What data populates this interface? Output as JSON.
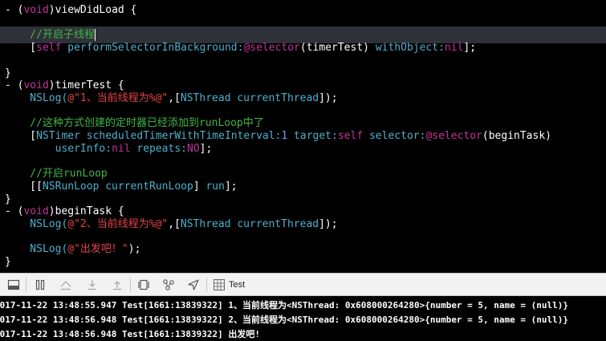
{
  "editor": {
    "lines": [
      [
        {
          "t": "- (",
          "c": "plain"
        },
        {
          "t": "void",
          "c": "keyword"
        },
        {
          "t": ")viewDidLoad {",
          "c": "plain"
        }
      ],
      [],
      [
        {
          "t": "    //开启子线程",
          "c": "comment"
        }
      ],
      [
        {
          "t": "    [",
          "c": "plain"
        },
        {
          "t": "self",
          "c": "keyword"
        },
        {
          "t": " performSelectorInBackground:",
          "c": "selector"
        },
        {
          "t": "@selector",
          "c": "keyword"
        },
        {
          "t": "(timerTest) ",
          "c": "plain"
        },
        {
          "t": "withObject:",
          "c": "selector"
        },
        {
          "t": "nil",
          "c": "keyword"
        },
        {
          "t": "];",
          "c": "plain"
        }
      ],
      [],
      [
        {
          "t": "}",
          "c": "plain"
        }
      ],
      [
        {
          "t": "- (",
          "c": "plain"
        },
        {
          "t": "void",
          "c": "keyword"
        },
        {
          "t": ")timerTest {",
          "c": "plain"
        }
      ],
      [
        {
          "t": "    NSLog(",
          "c": "selector"
        },
        {
          "t": "@\"1、当前线程为%@\"",
          "c": "string"
        },
        {
          "t": ",[",
          "c": "plain"
        },
        {
          "t": "NSThread currentThread",
          "c": "selector"
        },
        {
          "t": "]);",
          "c": "plain"
        }
      ],
      [],
      [
        {
          "t": "    //这种方式创建的定时器已经添加到runLoop中了",
          "c": "comment"
        }
      ],
      [
        {
          "t": "    [",
          "c": "plain"
        },
        {
          "t": "NSTimer scheduledTimerWithTimeInterval:",
          "c": "selector"
        },
        {
          "t": "1",
          "c": "number"
        },
        {
          "t": " target:",
          "c": "selector"
        },
        {
          "t": "self",
          "c": "keyword"
        },
        {
          "t": " selector:",
          "c": "selector"
        },
        {
          "t": "@selector",
          "c": "keyword"
        },
        {
          "t": "(beginTask)",
          "c": "plain"
        }
      ],
      [
        {
          "t": "        userInfo:",
          "c": "selector"
        },
        {
          "t": "nil",
          "c": "keyword"
        },
        {
          "t": " repeats:",
          "c": "selector"
        },
        {
          "t": "NO",
          "c": "keyword"
        },
        {
          "t": "];",
          "c": "plain"
        }
      ],
      [],
      [
        {
          "t": "    //开启runLoop",
          "c": "comment"
        }
      ],
      [
        {
          "t": "    [[",
          "c": "plain"
        },
        {
          "t": "NSRunLoop currentRunLoop",
          "c": "selector"
        },
        {
          "t": "] ",
          "c": "plain"
        },
        {
          "t": "run",
          "c": "selector"
        },
        {
          "t": "];",
          "c": "plain"
        }
      ],
      [
        {
          "t": "}",
          "c": "plain"
        }
      ],
      [
        {
          "t": "- (",
          "c": "plain"
        },
        {
          "t": "void",
          "c": "keyword"
        },
        {
          "t": ")beginTask {",
          "c": "plain"
        }
      ],
      [
        {
          "t": "    NSLog(",
          "c": "selector"
        },
        {
          "t": "@\"2、当前线程为%@\"",
          "c": "string"
        },
        {
          "t": ",[",
          "c": "plain"
        },
        {
          "t": "NSThread currentThread",
          "c": "selector"
        },
        {
          "t": "]);",
          "c": "plain"
        }
      ],
      [],
      [
        {
          "t": "    NSLog(",
          "c": "selector"
        },
        {
          "t": "@\"出发吧！\"",
          "c": "string"
        },
        {
          "t": ");",
          "c": "plain"
        }
      ],
      [
        {
          "t": "}",
          "c": "plain"
        }
      ]
    ]
  },
  "debug_bar": {
    "buttons": [
      {
        "name": "toggle-console-button",
        "icon": "console-toggle-icon"
      },
      {
        "name": "pause-button",
        "icon": "pause-icon"
      },
      {
        "name": "step-over-button",
        "icon": "step-over-icon"
      },
      {
        "name": "step-into-button",
        "icon": "step-into-icon"
      },
      {
        "name": "step-out-button",
        "icon": "step-out-icon"
      },
      {
        "name": "view-hierarchy-button",
        "icon": "view-hierarchy-icon"
      },
      {
        "name": "memory-graph-button",
        "icon": "memory-graph-icon"
      },
      {
        "name": "location-button",
        "icon": "location-arrow-icon"
      },
      {
        "name": "target-button",
        "icon": "target-app-icon"
      }
    ],
    "target_label": "Test"
  },
  "console": {
    "logs": [
      "2017-11-22 13:48:55.947 Test[1661:13839322] 1、当前线程为<NSThread: 0x608000264280>{number = 5, name = (null)}",
      "2017-11-22 13:48:56.948 Test[1661:13839322] 2、当前线程为<NSThread: 0x608000264280>{number = 5, name = (null)}",
      "2017-11-22 13:48:56.948 Test[1661:13839322] 出发吧!"
    ]
  },
  "colors": {
    "background": "#000000",
    "current_line": "#2f3138",
    "comment": "#41b645",
    "keyword": "#c2349b",
    "selector": "#4eb0cc",
    "string": "#e44347",
    "number": "#8b87ff",
    "plain": "#ffffff"
  }
}
